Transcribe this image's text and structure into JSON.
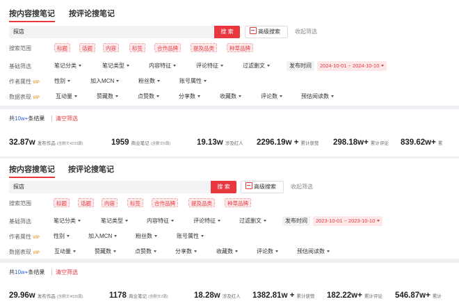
{
  "blocks": [
    {
      "tabs": {
        "active": "按内容搜笔记",
        "inactive": "按评论搜笔记"
      },
      "search": {
        "value": "探店",
        "button": "搜 索",
        "advanced": "高级搜索",
        "collapse": "收起筛选"
      },
      "scope": {
        "label": "搜索范围",
        "tags": [
          "标题",
          "话题",
          "内容",
          "标签",
          "合作品牌",
          "提及品类",
          "种草品牌"
        ]
      },
      "basic": {
        "label": "基础筛选",
        "items": [
          "笔记分类",
          "笔记类型",
          "内容特征",
          "评论特征",
          "过滤删文"
        ],
        "date_label": "发布时间",
        "date_range": "2024-10-01 ~ 2024-10-10"
      },
      "author": {
        "label": "作者属性",
        "vip": "VIP",
        "items": [
          "性别",
          "加入MCN",
          "粉丝数",
          "账号属性"
        ]
      },
      "data": {
        "label": "数据表现",
        "vip": "VIP",
        "items": [
          "互动量",
          "赞藏数",
          "点赞数",
          "分享数",
          "收藏数",
          "评论数",
          "预估阅读数"
        ]
      },
      "results": {
        "prefix": "共",
        "count": "10w+",
        "suffix": "条结果",
        "clear": "清空筛选"
      },
      "stats": [
        {
          "value": "32.87w",
          "label": "发布作品",
          "sub": "(含删文4233篇)"
        },
        {
          "value": "1959",
          "label": "商业笔记",
          "sub": "(含删文6篇)"
        },
        {
          "value": "19.13w",
          "label": "涉及红人",
          "sub": ""
        },
        {
          "value": "2296.19w +",
          "label": "累计获赞",
          "sub": ""
        },
        {
          "value": "298.18w+",
          "label": "累计评论",
          "sub": ""
        },
        {
          "value": "839.62w+",
          "label": "累",
          "sub": ""
        }
      ]
    },
    {
      "tabs": {
        "active": "按内容搜笔记",
        "inactive": "按评论搜笔记"
      },
      "search": {
        "value": "探店",
        "button": "搜 索",
        "advanced": "高级搜索",
        "collapse": "收起筛选"
      },
      "scope": {
        "label": "搜索范围",
        "tags": [
          "标题",
          "话题",
          "内容",
          "标签",
          "合作品牌",
          "提及品类",
          "种草品牌"
        ]
      },
      "basic": {
        "label": "基础筛选",
        "items": [
          "笔记分类",
          "笔记类型",
          "内容特征",
          "评论特征",
          "过滤删文"
        ],
        "date_label": "发布时间",
        "date_range": "2023-10-01 ~ 2023-10-10"
      },
      "author": {
        "label": "作者属性",
        "vip": "VIP",
        "items": [
          "性别",
          "加入MCN",
          "粉丝数",
          "账号属性"
        ]
      },
      "data": {
        "label": "数据表现",
        "vip": "VIP",
        "items": [
          "互动量",
          "赞藏数",
          "点赞数",
          "分享数",
          "收藏数",
          "评论数",
          "预估阅读数"
        ]
      },
      "results": {
        "prefix": "共",
        "count": "10w+",
        "suffix": "条结果",
        "clear": "清空筛选"
      },
      "stats": [
        {
          "value": "29.96w",
          "label": "发布作品",
          "sub": "(含删文4035篇)"
        },
        {
          "value": "1178",
          "label": "商业笔记",
          "sub": "(含删文2篇)"
        },
        {
          "value": "18.28w",
          "label": "涉及红人",
          "sub": ""
        },
        {
          "value": "1382.81w +",
          "label": "累计获赞",
          "sub": ""
        },
        {
          "value": "182.22w+",
          "label": "累计评论",
          "sub": ""
        },
        {
          "value": "546.87w+",
          "label": "累计",
          "sub": ""
        }
      ]
    }
  ]
}
